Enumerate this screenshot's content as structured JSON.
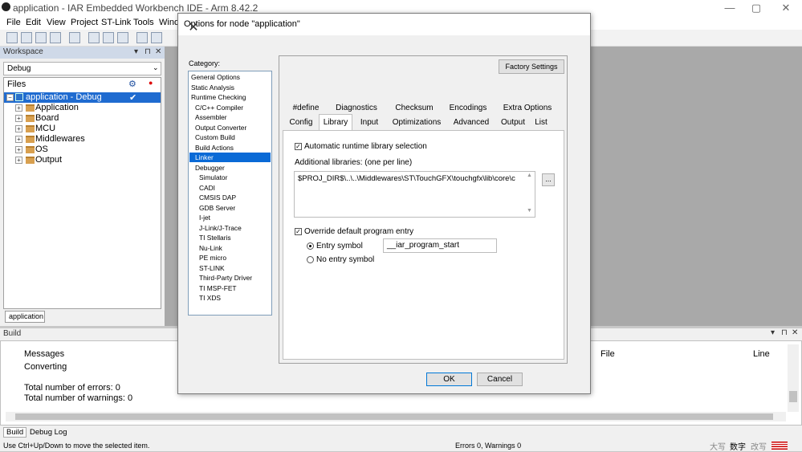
{
  "app": {
    "title": "application - IAR Embedded Workbench IDE - Arm 8.42.2",
    "minimize": "—",
    "maximize": "▢",
    "close": "✕"
  },
  "menu": [
    "File",
    "Edit",
    "View",
    "Project",
    "ST-Link",
    "Tools",
    "Wind"
  ],
  "workspace": {
    "header": "Workspace",
    "config": "Debug",
    "files_label": "Files",
    "root": "application - Debug",
    "items": [
      "Application",
      "Board",
      "MCU",
      "Middlewares",
      "OS",
      "Output"
    ],
    "tab": "application"
  },
  "build": {
    "header": "Build",
    "col_messages": "Messages",
    "col_file": "File",
    "col_line": "Line",
    "lines": [
      "Converting",
      "",
      "Total number of errors: 0",
      "Total number of warnings: 0"
    ],
    "tabs": [
      "Build",
      "Debug Log"
    ]
  },
  "status": {
    "hint": "Use Ctrl+Up/Down to move the selected item.",
    "summary": "Errors 0, Warnings 0",
    "ime": [
      "大写",
      "数字",
      "改写"
    ]
  },
  "dialog": {
    "title": "Options for node \"application\"",
    "category_label": "Category:",
    "categories": [
      {
        "label": "General Options",
        "indent": 0
      },
      {
        "label": "Static Analysis",
        "indent": 0
      },
      {
        "label": "Runtime Checking",
        "indent": 0
      },
      {
        "label": "C/C++ Compiler",
        "indent": 1
      },
      {
        "label": "Assembler",
        "indent": 1
      },
      {
        "label": "Output Converter",
        "indent": 1
      },
      {
        "label": "Custom Build",
        "indent": 1
      },
      {
        "label": "Build Actions",
        "indent": 1
      },
      {
        "label": "Linker",
        "indent": 1,
        "selected": true
      },
      {
        "label": "Debugger",
        "indent": 1
      },
      {
        "label": "Simulator",
        "indent": 2
      },
      {
        "label": "CADI",
        "indent": 2
      },
      {
        "label": "CMSIS DAP",
        "indent": 2
      },
      {
        "label": "GDB Server",
        "indent": 2
      },
      {
        "label": "I-jet",
        "indent": 2
      },
      {
        "label": "J-Link/J-Trace",
        "indent": 2
      },
      {
        "label": "TI Stellaris",
        "indent": 2
      },
      {
        "label": "Nu-Link",
        "indent": 2
      },
      {
        "label": "PE micro",
        "indent": 2
      },
      {
        "label": "ST-LINK",
        "indent": 2
      },
      {
        "label": "Third-Party Driver",
        "indent": 2
      },
      {
        "label": "TI MSP-FET",
        "indent": 2
      },
      {
        "label": "TI XDS",
        "indent": 2
      }
    ],
    "factory_settings": "Factory Settings",
    "tabs_row1": [
      "#define",
      "Diagnostics",
      "Checksum",
      "Encodings",
      "Extra Options"
    ],
    "tabs_row2": [
      "Config",
      "Library",
      "Input",
      "Optimizations",
      "Advanced",
      "Output",
      "List"
    ],
    "active_tab": "Library",
    "auto_lib": {
      "label": "Automatic runtime library selection",
      "checked": true
    },
    "additional_libs_label": "Additional libraries: (one per line)",
    "additional_libs_value": "$PROJ_DIR$\\..\\..\\Middlewares\\ST\\TouchGFX\\touchgfx\\lib\\core\\c",
    "browse": "...",
    "override": {
      "label": "Override default program entry",
      "checked": true
    },
    "entry_symbol": {
      "label": "Entry symbol",
      "selected": true,
      "value": "__iar_program_start"
    },
    "no_entry": {
      "label": "No entry symbol",
      "selected": false
    },
    "ok": "OK",
    "cancel": "Cancel"
  }
}
